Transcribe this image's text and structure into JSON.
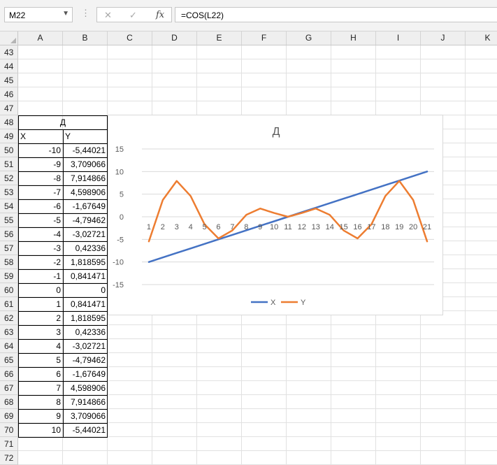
{
  "formula_bar": {
    "name_box": "M22",
    "cancel_icon": "✕",
    "enter_icon": "✓",
    "fx_label": "fx",
    "formula": "=COS(L22)"
  },
  "columns": [
    "A",
    "B",
    "C",
    "D",
    "E",
    "F",
    "G",
    "H",
    "I",
    "J",
    "K"
  ],
  "rows": [
    "43",
    "44",
    "45",
    "46",
    "47",
    "48",
    "49",
    "50",
    "51",
    "52",
    "53",
    "54",
    "55",
    "56",
    "57",
    "58",
    "59",
    "60",
    "61",
    "62",
    "63",
    "64",
    "65",
    "66",
    "67",
    "68",
    "69",
    "70",
    "71",
    "72"
  ],
  "table": {
    "title": "Д",
    "header_x": "X",
    "header_y": "Y",
    "x_values": [
      "-10",
      "-9",
      "-8",
      "-7",
      "-6",
      "-5",
      "-4",
      "-3",
      "-2",
      "-1",
      "0",
      "1",
      "2",
      "3",
      "4",
      "5",
      "6",
      "7",
      "8",
      "9",
      "10"
    ],
    "y_values": [
      "-5,44021",
      "3,709066",
      "7,914866",
      "4,598906",
      "-1,67649",
      "-4,79462",
      "-3,02721",
      "0,42336",
      "1,818595",
      "0,841471",
      "0",
      "0,841471",
      "1,818595",
      "0,42336",
      "-3,02721",
      "-4,79462",
      "-1,67649",
      "4,598906",
      "7,914866",
      "3,709066",
      "-5,44021"
    ]
  },
  "chart_data": {
    "type": "line",
    "title": "Д",
    "categories": [
      "1",
      "2",
      "3",
      "4",
      "5",
      "6",
      "7",
      "8",
      "9",
      "10",
      "11",
      "12",
      "13",
      "14",
      "15",
      "16",
      "17",
      "18",
      "19",
      "20",
      "21"
    ],
    "y_ticks": [
      "15",
      "10",
      "5",
      "0",
      "-5",
      "-10",
      "-15"
    ],
    "ylim": [
      -15,
      15
    ],
    "grid": true,
    "legend": "bottom",
    "series": [
      {
        "name": "X",
        "color": "#4472c4",
        "values": [
          -10,
          -9,
          -8,
          -7,
          -6,
          -5,
          -4,
          -3,
          -2,
          -1,
          0,
          1,
          2,
          3,
          4,
          5,
          6,
          7,
          8,
          9,
          10
        ]
      },
      {
        "name": "Y",
        "color": "#ed7d31",
        "values": [
          -5.44021,
          3.709066,
          7.914866,
          4.598906,
          -1.67649,
          -4.79462,
          -3.02721,
          0.42336,
          1.818595,
          0.841471,
          0,
          0.841471,
          1.818595,
          0.42336,
          -3.02721,
          -4.79462,
          -1.67649,
          4.598906,
          7.914866,
          3.709066,
          -5.44021
        ]
      }
    ]
  }
}
